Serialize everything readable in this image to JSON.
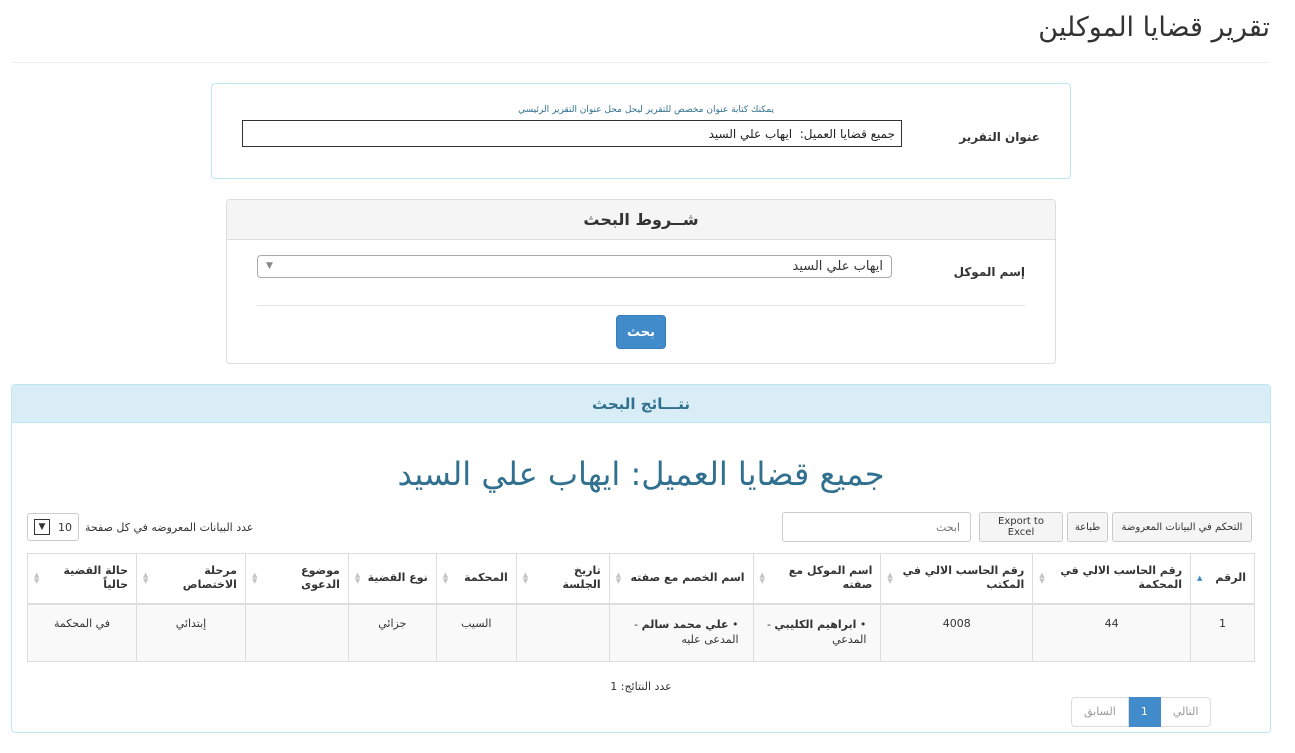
{
  "page": {
    "title": "تقرير قضايا الموكلين"
  },
  "report_title": {
    "label": "عنوان التقرير",
    "hint": "يمكنك كتابة عنوان مخصص للتقرير ليحل محل عنوان التقرير الرئيسي",
    "value": "جميع قضايا العميل:  ايهاب علي السيد"
  },
  "criteria": {
    "heading": "شــروط البحث",
    "client_label": "إسم الموكل",
    "client_value": "ايهاب علي السيد",
    "search_button": "بحث"
  },
  "results": {
    "heading": "نتـــائج البحث",
    "title": "جميع قضايا العميل: ايهاب علي السيد",
    "toolbar": {
      "colvis": "التحكم في البيانات المعروضة",
      "print": "طباعة",
      "excel": "Export to Excel",
      "search_placeholder": "ابحث"
    },
    "page_length": {
      "value": "10",
      "label": "عدد البيانات المعروضه في كل صفحة"
    },
    "columns": [
      "الرقم",
      "رقم الحاسب الالي في المحكمة",
      "رقم الحاسب الالي في المكتب",
      "اسم الموكل مع صفته",
      "اسم الخصم مع صفته",
      "تاريخ الجلسة",
      "المحكمة",
      "نوع القضية",
      "موضوع الدعوى",
      "مرحلة الاختصاص",
      "حالة القضية حالياً"
    ],
    "rows": [
      {
        "num": "1",
        "court_no": "44",
        "office_no": "4008",
        "client_name": "ابراهيم الكليبي",
        "client_role": "المدعي",
        "opponent_name": "علي محمد سالم",
        "opponent_role": "المدعى عليه",
        "session_date": "",
        "court": "السيب",
        "case_type": "جزائي",
        "subject": "",
        "stage": "إبتدائي",
        "status": "في المحكمة"
      }
    ],
    "count_text": "عدد النتائج: 1",
    "pagination": {
      "next": "التالي",
      "current": "1",
      "prev": "السابق"
    }
  }
}
